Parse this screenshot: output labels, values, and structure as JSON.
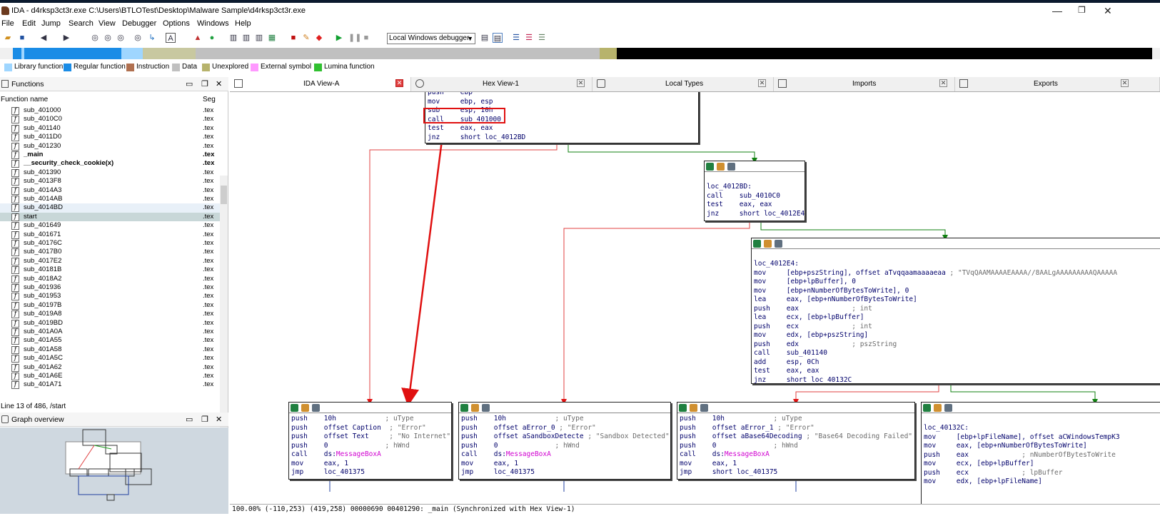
{
  "window": {
    "title": "IDA - d4rksp3ct3r.exe C:\\Users\\BTLOTest\\Desktop\\Malware Sample\\d4rksp3ct3r.exe",
    "minimize": "—",
    "restore": "❐",
    "close": "✕"
  },
  "menu": [
    "File",
    "Edit",
    "Jump",
    "Search",
    "View",
    "Debugger",
    "Options",
    "Windows",
    "Help"
  ],
  "toolbar": {
    "debugger_select": "Local Windows debugger"
  },
  "legend": [
    {
      "label": "Library function",
      "color": "#9fd6ff"
    },
    {
      "label": "Regular function",
      "color": "#1a8ce6"
    },
    {
      "label": "Instruction",
      "color": "#b07050"
    },
    {
      "label": "Data",
      "color": "#c0c0c0"
    },
    {
      "label": "Unexplored",
      "color": "#b7b36c"
    },
    {
      "label": "External symbol",
      "color": "#ff99ff"
    },
    {
      "label": "Lumina function",
      "color": "#30c030"
    }
  ],
  "functions_pane": {
    "title": "Functions",
    "col_name": "Function name",
    "col_seg": "Seg",
    "rows": [
      {
        "name": "sub_401000",
        "seg": ".tex"
      },
      {
        "name": "sub_4010C0",
        "seg": ".tex"
      },
      {
        "name": "sub_401140",
        "seg": ".tex"
      },
      {
        "name": "sub_4011D0",
        "seg": ".tex"
      },
      {
        "name": "sub_401230",
        "seg": ".tex"
      },
      {
        "name": "_main",
        "seg": ".tex",
        "bold": true
      },
      {
        "name": "__security_check_cookie(x)",
        "seg": ".tex",
        "bold": true
      },
      {
        "name": "sub_401390",
        "seg": ".tex"
      },
      {
        "name": "sub_4013F8",
        "seg": ".tex"
      },
      {
        "name": "sub_4014A3",
        "seg": ".tex"
      },
      {
        "name": "sub_4014AB",
        "seg": ".tex"
      },
      {
        "name": "sub_4014BD",
        "seg": ".tex",
        "alt": true
      },
      {
        "name": "start",
        "seg": ".tex",
        "selected": true
      },
      {
        "name": "sub_401649",
        "seg": ".tex"
      },
      {
        "name": "sub_401671",
        "seg": ".tex"
      },
      {
        "name": "sub_40176C",
        "seg": ".tex"
      },
      {
        "name": "sub_4017B0",
        "seg": ".tex"
      },
      {
        "name": "sub_4017E2",
        "seg": ".tex"
      },
      {
        "name": "sub_40181B",
        "seg": ".tex"
      },
      {
        "name": "sub_4018A2",
        "seg": ".tex"
      },
      {
        "name": "sub_401936",
        "seg": ".tex"
      },
      {
        "name": "sub_401953",
        "seg": ".tex"
      },
      {
        "name": "sub_40197B",
        "seg": ".tex"
      },
      {
        "name": "sub_4019A8",
        "seg": ".tex"
      },
      {
        "name": "sub_4019BD",
        "seg": ".tex"
      },
      {
        "name": "sub_401A0A",
        "seg": ".tex"
      },
      {
        "name": "sub_401A55",
        "seg": ".tex"
      },
      {
        "name": "sub_401A58",
        "seg": ".tex"
      },
      {
        "name": "sub_401A5C",
        "seg": ".tex"
      },
      {
        "name": "sub_401A62",
        "seg": ".tex"
      },
      {
        "name": "sub_401A6E",
        "seg": ".tex"
      },
      {
        "name": "sub_401A71",
        "seg": ".tex"
      }
    ],
    "status": "Line 13 of 486, /start"
  },
  "graph_overview": {
    "title": "Graph overview"
  },
  "tabs": [
    {
      "label": "IDA View-A",
      "active": true
    },
    {
      "label": "Hex View-1"
    },
    {
      "label": "Local Types"
    },
    {
      "label": "Imports"
    },
    {
      "label": "Exports"
    }
  ],
  "blocks": {
    "top": [
      "push    ebp",
      "mov     ebp, esp",
      "sub     esp, 10h",
      "call    sub_401000",
      "test    eax, eax",
      "jnz     short loc_4012BD"
    ],
    "b4012BD": [
      "loc_4012BD:",
      "call    sub_4010C0",
      "test    eax, eax",
      "jnz     short loc_4012E4"
    ],
    "b4012E4_label": "loc_4012E4:",
    "b4012E4": [
      {
        "ins": "mov     [ebp+pszString], offset aTvqqaamaaaaeaa",
        "cmt": " ; \"TVqQAAMAAAAEAAAA//8AALgAAAAAAAAAQAAAAA"
      },
      {
        "ins": "mov     [ebp+lpBuffer], 0",
        "cmt": ""
      },
      {
        "ins": "mov     [ebp+nNumberOfBytesToWrite], 0",
        "cmt": ""
      },
      {
        "ins": "lea     eax, [ebp+nNumberOfBytesToWrite]",
        "cmt": ""
      },
      {
        "ins": "push    eax",
        "cmt": "             ; int"
      },
      {
        "ins": "lea     ecx, [ebp+lpBuffer]",
        "cmt": ""
      },
      {
        "ins": "push    ecx",
        "cmt": "             ; int"
      },
      {
        "ins": "mov     edx, [ebp+pszString]",
        "cmt": ""
      },
      {
        "ins": "push    edx",
        "cmt": "             ; pszString"
      },
      {
        "ins": "call    sub_401140",
        "cmt": ""
      },
      {
        "ins": "add     esp, 0Ch",
        "cmt": ""
      },
      {
        "ins": "test    eax, eax",
        "cmt": ""
      },
      {
        "ins": "jnz     short loc_40132C",
        "cmt": ""
      }
    ],
    "noint": [
      {
        "ins": "push    10h",
        "cmt": "            ; uType"
      },
      {
        "ins": "push    offset Caption",
        "cmt": "  ; \"Error\""
      },
      {
        "ins": "push    offset Text",
        "cmt": "     ; \"No Internet\""
      },
      {
        "ins": "push    0",
        "cmt": "              ; hWnd"
      },
      {
        "ins": "call    ds:",
        "api": "MessageBoxA"
      },
      {
        "ins": "mov     eax, 1",
        "cmt": ""
      },
      {
        "ins": "jmp     loc_401375",
        "cmt": ""
      }
    ],
    "sandbox": [
      {
        "ins": "push    10h",
        "cmt": "            ; uType"
      },
      {
        "ins": "push    offset aError_0",
        "cmt": " ; \"Error\""
      },
      {
        "ins": "push    offset aSandboxDetecte",
        "cmt": " ; \"Sandbox Detected\""
      },
      {
        "ins": "push    0",
        "cmt": "              ; hWnd"
      },
      {
        "ins": "call    ds:",
        "api": "MessageBoxA"
      },
      {
        "ins": "mov     eax, 1",
        "cmt": ""
      },
      {
        "ins": "jmp     loc_401375",
        "cmt": ""
      }
    ],
    "b64": [
      {
        "ins": "push    10h",
        "cmt": "            ; uType"
      },
      {
        "ins": "push    offset aError_1",
        "cmt": " ; \"Error\""
      },
      {
        "ins": "push    offset aBase64Decoding",
        "cmt": " ; \"Base64 Decoding Failed\""
      },
      {
        "ins": "push    0",
        "cmt": "              ; hWnd"
      },
      {
        "ins": "call    ds:",
        "api": "MessageBoxA"
      },
      {
        "ins": "mov     eax, 1",
        "cmt": ""
      },
      {
        "ins": "jmp     short loc_401375",
        "cmt": ""
      }
    ],
    "b40132C_label": "loc_40132C:",
    "b40132C": [
      {
        "ins": "mov     [ebp+lpFileName], offset aCWindowsTempK3",
        "cmt": ""
      },
      {
        "ins": "mov     eax, [ebp+nNumberOfBytesToWrite]",
        "cmt": ""
      },
      {
        "ins": "push    eax",
        "cmt": "             ; nNumberOfBytesToWrite"
      },
      {
        "ins": "mov     ecx, [ebp+lpBuffer]",
        "cmt": ""
      },
      {
        "ins": "push    ecx",
        "cmt": "             ; lpBuffer"
      },
      {
        "ins": "mov     edx, [ebp+lpFileName]",
        "cmt": ""
      }
    ]
  },
  "statusbar": "100.00% (-110,253) (419,258) 00000690 00401290: _main (Synchronized with Hex View-1)"
}
